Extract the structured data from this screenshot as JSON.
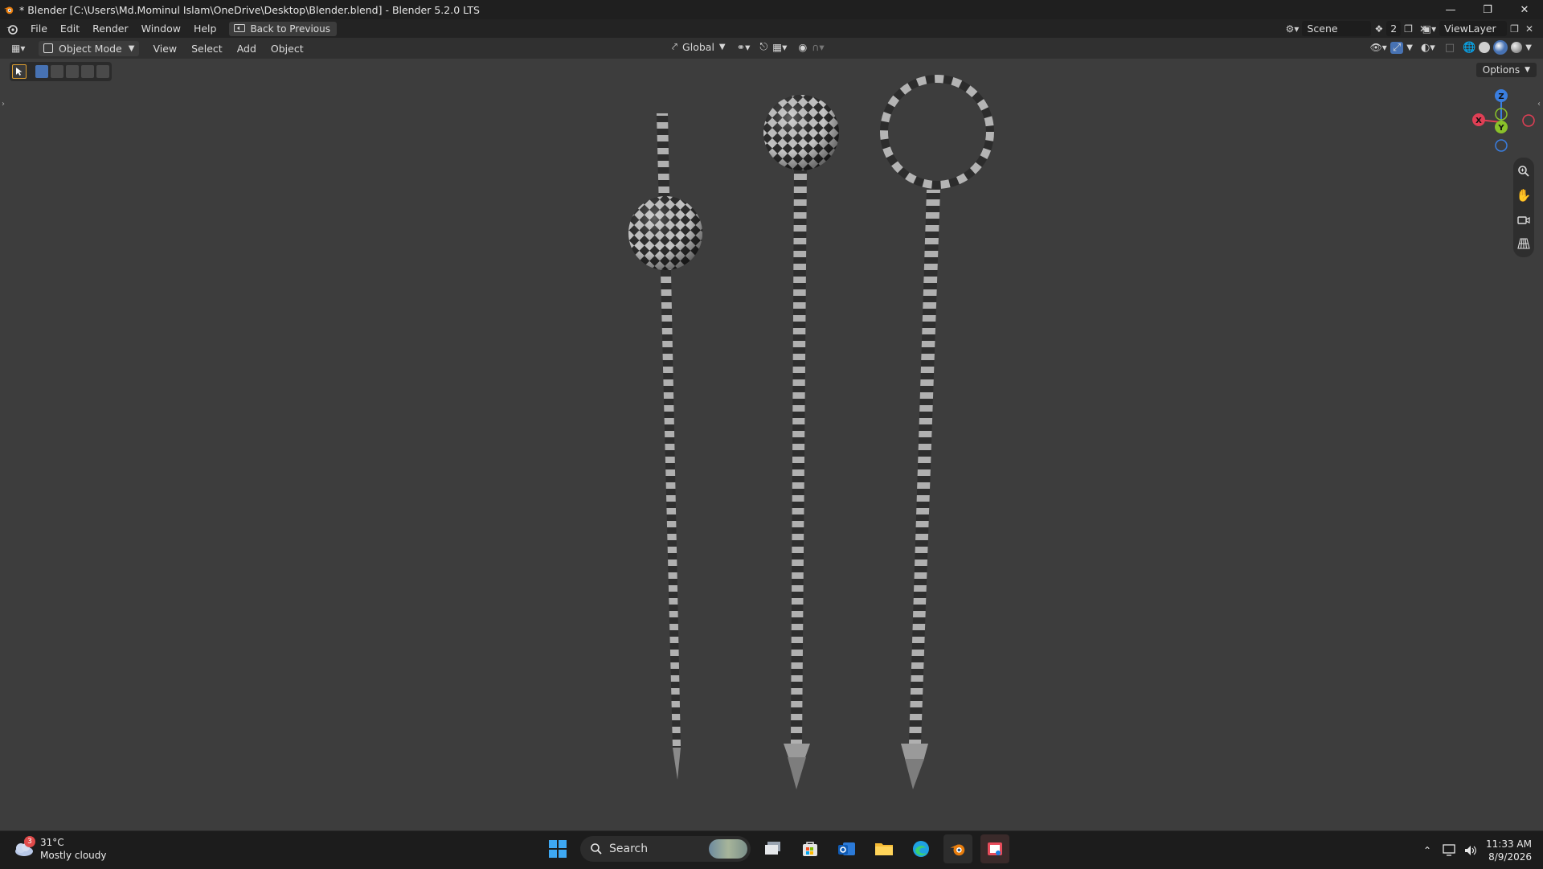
{
  "window": {
    "title": "* Blender [C:\\Users\\Md.Mominul Islam\\OneDrive\\Desktop\\Blender.blend] - Blender 5.2.0 LTS"
  },
  "menubar": {
    "items": [
      "File",
      "Edit",
      "Render",
      "Window",
      "Help"
    ],
    "back_button": "Back to Previous",
    "scene_name": "Scene",
    "scene_count": "2",
    "view_layer": "ViewLayer"
  },
  "viewport_header": {
    "mode": "Object Mode",
    "menus": [
      "View",
      "Select",
      "Add",
      "Object"
    ],
    "transform_orientation": "Global",
    "options_label": "Options"
  },
  "gizmo": {
    "x_label": "X",
    "y_label": "Y",
    "z_label": "Z",
    "x_color": "#e03f55",
    "y_color": "#8ac12a",
    "z_color": "#3a7ee0"
  },
  "scene_objects": [
    {
      "name": "pin-with-sphere-mid",
      "icon": "checker-pin"
    },
    {
      "name": "pin-with-sphere-top",
      "icon": "checker-pin"
    },
    {
      "name": "pin-with-ring-top",
      "icon": "checker-pin"
    }
  ],
  "taskbar": {
    "weather_temp": "31°C",
    "weather_desc": "Mostly cloudy",
    "weather_badge": "3",
    "search_label": "Search",
    "time": "11:33 AM",
    "date": "8/9/2026"
  },
  "colors": {
    "accent": "#4772b3",
    "viewport_bg": "#3d3d3d",
    "checker_light": "#b4b4b4",
    "checker_dark": "#2a2a2a"
  }
}
